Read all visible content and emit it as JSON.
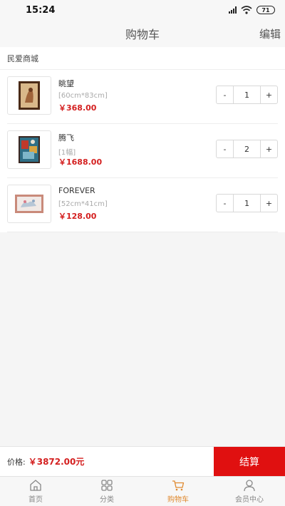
{
  "status": {
    "time": "15:24",
    "battery": "71"
  },
  "nav": {
    "title": "购物车",
    "edit": "编辑"
  },
  "shop": {
    "name": "民爱商城"
  },
  "items": [
    {
      "name": "眺望",
      "spec": "[60cm*83cm]",
      "price": "￥368.00",
      "qty": "1",
      "minus": "-",
      "plus": "+"
    },
    {
      "name": "腾飞",
      "spec": "[1幅]",
      "price": "￥1688.00",
      "qty": "2",
      "minus": "-",
      "plus": "+"
    },
    {
      "name": "FOREVER",
      "spec": "[52cm*41cm]",
      "price": "￥128.00",
      "qty": "1",
      "minus": "-",
      "plus": "+"
    }
  ],
  "checkout": {
    "label": "价格:",
    "total": "￥3872.00元",
    "button": "结算"
  },
  "tabs": [
    {
      "label": "首页",
      "icon": "home-icon"
    },
    {
      "label": "分类",
      "icon": "category-icon"
    },
    {
      "label": "购物车",
      "icon": "cart-icon",
      "active": true
    },
    {
      "label": "会员中心",
      "icon": "user-icon"
    }
  ],
  "colors": {
    "accent": "#e01010",
    "price": "#d42020",
    "active_tab": "#e08a30"
  }
}
